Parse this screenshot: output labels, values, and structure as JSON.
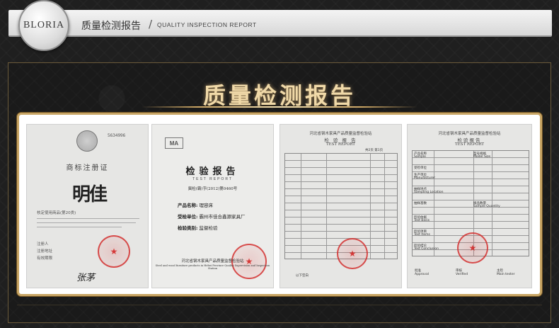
{
  "header": {
    "brand": "BLORIA",
    "title_cn": "质量检测报告",
    "slash": "/",
    "title_en": "QUALITY INSPECTION REPORT"
  },
  "banner": {
    "title": "质量检测报告"
  },
  "documents": [
    {
      "name": "trademark-certificate",
      "number": "5634996",
      "title": "商标注册证",
      "mark": "明佳",
      "labels": [
        "核定使用商品(第20类)",
        "注册人",
        "注册地址",
        "有效期限"
      ],
      "signature": "张茅"
    },
    {
      "name": "test-report-cover",
      "logo": "MA",
      "title": "检验报告",
      "subtitle": "TEST REPORT",
      "code": "冀检(霸)字(2012)第0460号",
      "rows": [
        {
          "label": "产品名称:",
          "value": "理容床"
        },
        {
          "label": "受检单位:",
          "value": "霸州市佳合鑫源家具厂"
        },
        {
          "label": "检验类别:",
          "value": "监督检验"
        }
      ],
      "footer_cn": "河北省钢木家具产品质量监督检验站",
      "footer_en": "Steel and wood furniture products in Hebei Province Quality Supervision and Inspection Station"
    },
    {
      "name": "test-report-table-1",
      "org": "河北省钢木家具产品质量监督检验站",
      "title": "检 验 报 告",
      "subtitle": "TEST REPORT",
      "page": "共2页 第1页",
      "footer": "以下空白"
    },
    {
      "name": "test-report-table-2",
      "org": "河北省钢木家具产品质量监督检验站",
      "title": "检验报告",
      "subtitle": "TEST REPORT",
      "cells": [
        "产品名称",
        "Sample",
        "型号规格",
        "Model Size",
        "受检单位",
        "生产单位",
        "Manufacturer",
        "抽样地点",
        "Sampling Location",
        "抽样基数",
        "样品数量",
        "Sample Quantity",
        "检验依据",
        "Test Basis",
        "检验项目",
        "Test Items",
        "检验结论",
        "Test Conclusion"
      ],
      "sign_labels": [
        "批准",
        "Approval",
        "审核",
        "Verified",
        "主检",
        "Main tester"
      ]
    }
  ],
  "colors": {
    "gold": "#c8a564",
    "title_glow": "#f0d9a8",
    "seal_red": "#d22828"
  }
}
